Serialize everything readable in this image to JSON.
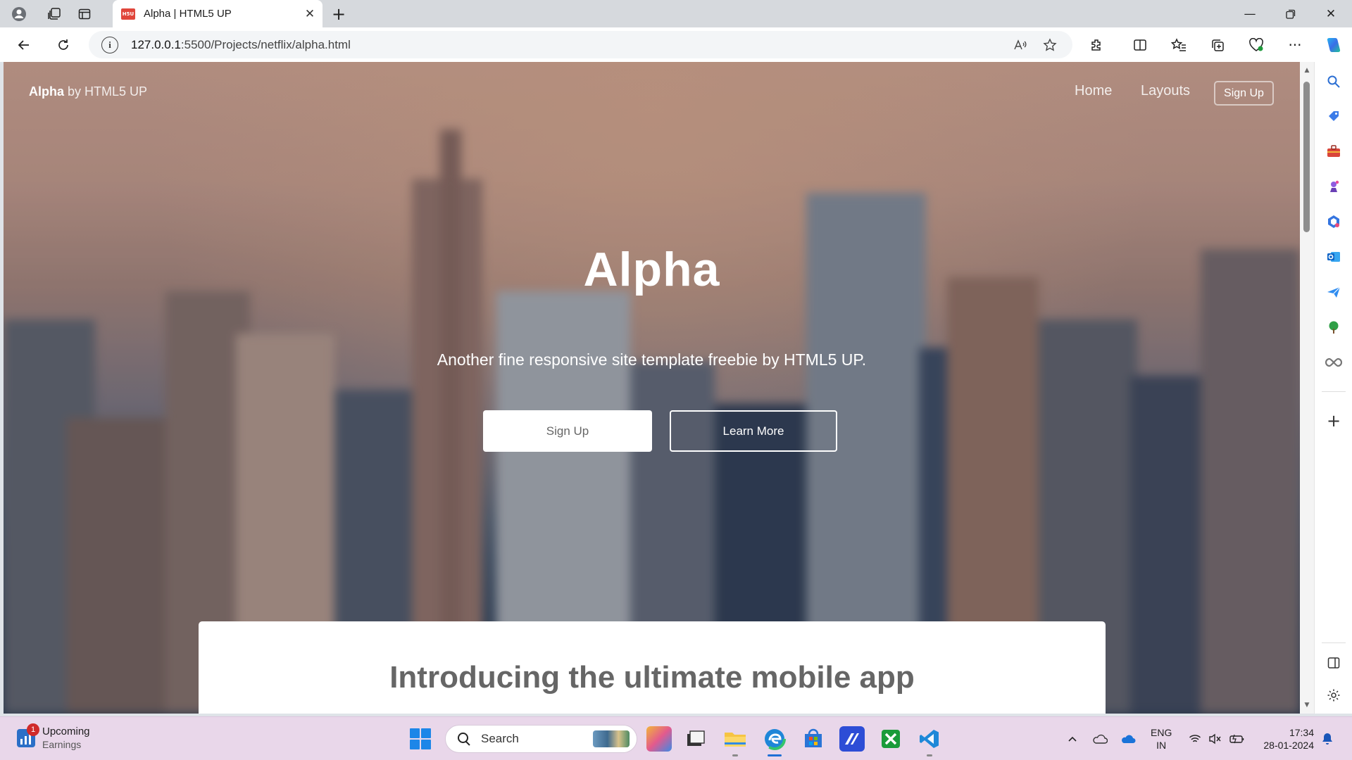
{
  "browser": {
    "tab": {
      "favicon_text": "H5U",
      "title": "Alpha | HTML5 UP"
    },
    "address": {
      "host": "127.0.0.1",
      "path": ":5500/Projects/netflix/alpha.html"
    }
  },
  "site": {
    "logo_strong": "Alpha",
    "logo_rest": " by HTML5 UP",
    "nav": {
      "home": "Home",
      "layouts": "Layouts",
      "signup": "Sign Up"
    },
    "hero": {
      "title": "Alpha",
      "subtitle": "Another fine responsive site template freebie by HTML5 UP.",
      "primary_button": "Sign Up",
      "secondary_button": "Learn More"
    },
    "section_heading": "Introducing the ultimate mobile app"
  },
  "taskbar": {
    "widget": {
      "badge": "1",
      "title": "Upcoming",
      "subtitle": "Earnings"
    },
    "search_placeholder": "Search",
    "language": {
      "line1": "ENG",
      "line2": "IN"
    },
    "clock": {
      "time": "17:34",
      "date": "28-01-2024"
    }
  },
  "colors": {
    "accent": "#1d6fd6",
    "tab_favicon": "#e0463b",
    "taskbar_bg": "#e9d7ea"
  }
}
